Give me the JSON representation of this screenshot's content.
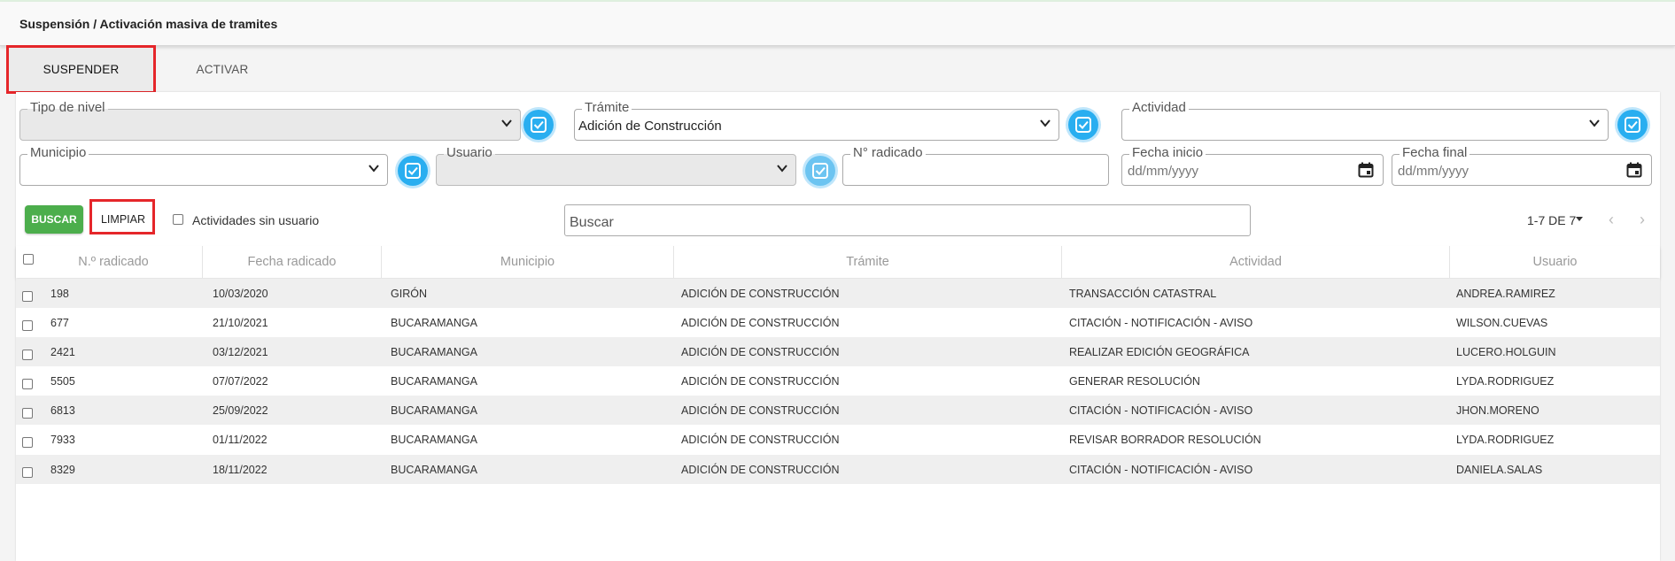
{
  "page": {
    "breadcrumb": "Suspensión / Activación masiva de tramites"
  },
  "tabs": [
    {
      "label": "SUSPENDER",
      "active": true
    },
    {
      "label": "ACTIVAR",
      "active": false
    }
  ],
  "filters": {
    "tipo_nivel": {
      "label": "Tipo de nivel",
      "value": ""
    },
    "tramite": {
      "label": "Trámite",
      "value": "Adición de Construcción"
    },
    "actividad": {
      "label": "Actividad",
      "value": ""
    },
    "municipio": {
      "label": "Municipio",
      "value": ""
    },
    "usuario": {
      "label": "Usuario",
      "value": ""
    },
    "radicado": {
      "label": "N° radicado",
      "value": ""
    },
    "fecha_inicio": {
      "label": "Fecha inicio",
      "placeholder": "dd/mm/yyyy"
    },
    "fecha_final": {
      "label": "Fecha final",
      "placeholder": "dd/mm/yyyy"
    }
  },
  "actions": {
    "buscar": "BUSCAR",
    "limpiar": "LIMPIAR",
    "sin_usuario": "Actividades sin usuario",
    "search_placeholder": "Buscar"
  },
  "pagination": {
    "text": "1-7 DE 7",
    "prev": "‹",
    "next": "›"
  },
  "table": {
    "columns": [
      "N.º radicado",
      "Fecha radicado",
      "Municipio",
      "Trámite",
      "Actividad",
      "Usuario"
    ],
    "rows": [
      [
        "198",
        "10/03/2020",
        "GIRÓN",
        "ADICIÓN DE CONSTRUCCIÓN",
        "TRANSACCIÓN CATASTRAL",
        "ANDREA.RAMIREZ"
      ],
      [
        "677",
        "21/10/2021",
        "BUCARAMANGA",
        "ADICIÓN DE CONSTRUCCIÓN",
        "CITACIÓN - NOTIFICACIÓN - AVISO",
        "WILSON.CUEVAS"
      ],
      [
        "2421",
        "03/12/2021",
        "BUCARAMANGA",
        "ADICIÓN DE CONSTRUCCIÓN",
        "REALIZAR EDICIÓN GEOGRÁFICA",
        "LUCERO.HOLGUIN"
      ],
      [
        "5505",
        "07/07/2022",
        "BUCARAMANGA",
        "ADICIÓN DE CONSTRUCCIÓN",
        "GENERAR RESOLUCIÓN",
        "LYDA.RODRIGUEZ"
      ],
      [
        "6813",
        "25/09/2022",
        "BUCARAMANGA",
        "ADICIÓN DE CONSTRUCCIÓN",
        "CITACIÓN - NOTIFICACIÓN - AVISO",
        "JHON.MORENO"
      ],
      [
        "7933",
        "01/11/2022",
        "BUCARAMANGA",
        "ADICIÓN DE CONSTRUCCIÓN",
        "REVISAR BORRADOR RESOLUCIÓN",
        "LYDA.RODRIGUEZ"
      ],
      [
        "8329",
        "18/11/2022",
        "BUCARAMANGA",
        "ADICIÓN DE CONSTRUCCIÓN",
        "CITACIÓN - NOTIFICACIÓN - AVISO",
        "DANIELA.SALAS"
      ]
    ]
  }
}
